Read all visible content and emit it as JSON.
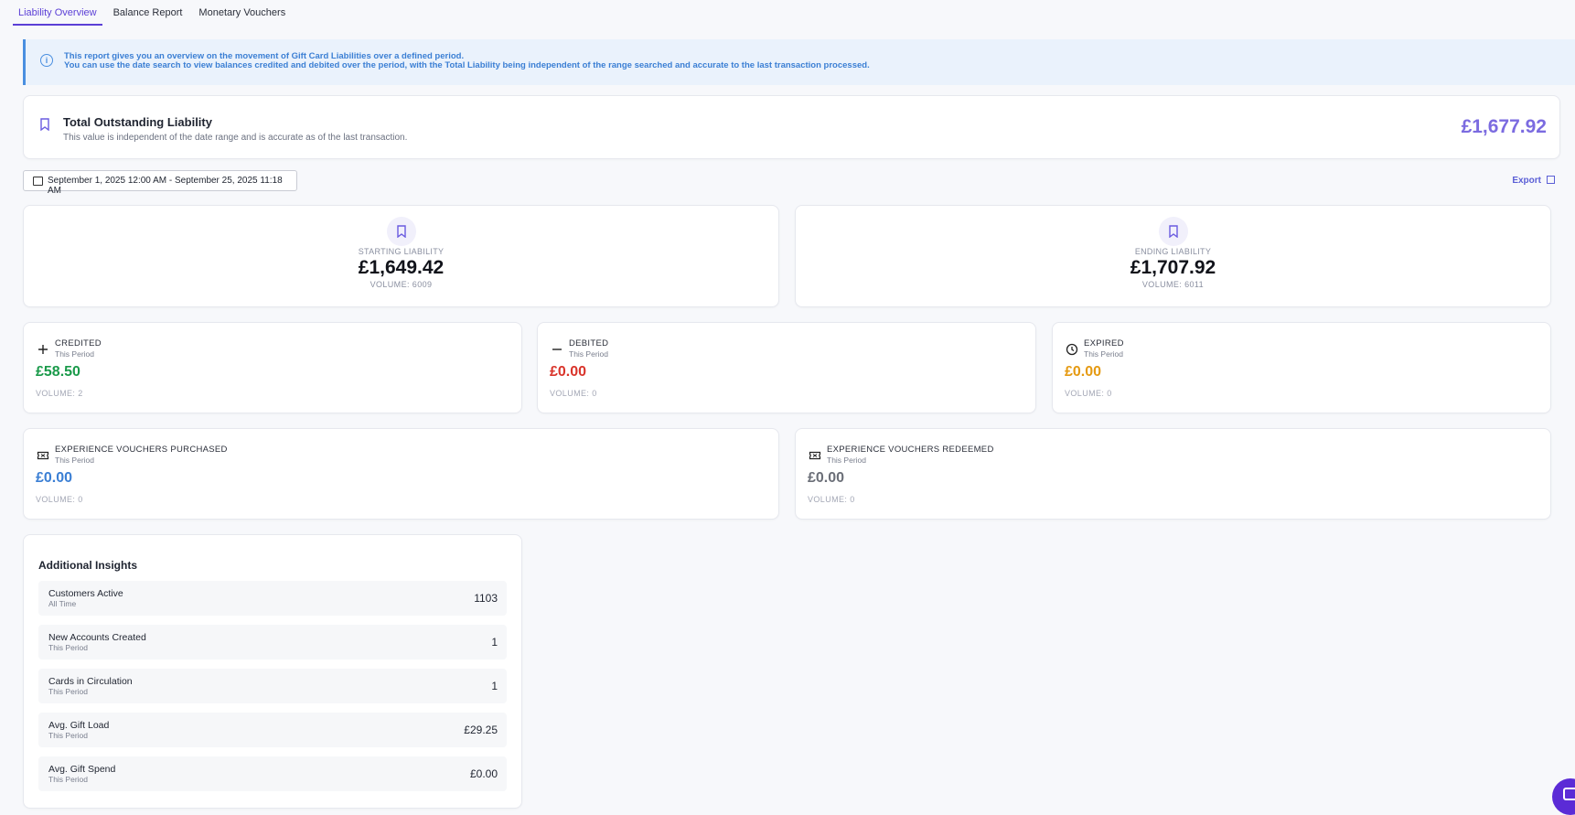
{
  "tabs": [
    {
      "label": "Liability Overview",
      "active": true
    },
    {
      "label": "Balance Report",
      "active": false
    },
    {
      "label": "Monetary Vouchers",
      "active": false
    }
  ],
  "info": {
    "line1": "This report gives you an overview on the movement of Gift Card Liabilities over a defined period.",
    "line2": "You can use the date search to view balances credited and debited over the period, with the Total Liability being independent of the range searched and accurate to the last transaction processed."
  },
  "total": {
    "title": "Total Outstanding Liability",
    "subtitle": "This value is independent of the date range and is accurate as of the last transaction.",
    "amount": "£1,677.92"
  },
  "date_range": "September 1, 2025 12:00 AM - September 25, 2025 11:18 AM",
  "export_label": "Export",
  "starting": {
    "label": "STARTING LIABILITY",
    "value": "£1,649.42",
    "volume": "VOLUME: 6009"
  },
  "ending": {
    "label": "ENDING LIABILITY",
    "value": "£1,707.92",
    "volume": "VOLUME: 6011"
  },
  "credited": {
    "label": "CREDITED",
    "period": "This Period",
    "value": "£58.50",
    "volume": "VOLUME: 2",
    "color": "#1a9a4a"
  },
  "debited": {
    "label": "DEBITED",
    "period": "This Period",
    "value": "£0.00",
    "volume": "VOLUME: 0",
    "color": "#d9342b"
  },
  "expired": {
    "label": "EXPIRED",
    "period": "This Period",
    "value": "£0.00",
    "volume": "VOLUME: 0",
    "color": "#e59a12"
  },
  "exp_purchased": {
    "label": "EXPERIENCE VOUCHERS PURCHASED",
    "period": "This Period",
    "value": "£0.00",
    "volume": "VOLUME: 0",
    "color": "#3b7fd4"
  },
  "exp_redeemed": {
    "label": "EXPERIENCE VOUCHERS REDEEMED",
    "period": "This Period",
    "value": "£0.00",
    "volume": "VOLUME: 0",
    "color": "#6b6f78"
  },
  "insights": {
    "title": "Additional Insights",
    "rows": [
      {
        "name": "Customers Active",
        "sub": "All Time",
        "value": "1103"
      },
      {
        "name": "New Accounts Created",
        "sub": "This Period",
        "value": "1"
      },
      {
        "name": "Cards in Circulation",
        "sub": "This Period",
        "value": "1"
      },
      {
        "name": "Avg. Gift Load",
        "sub": "This Period",
        "value": "£29.25"
      },
      {
        "name": "Avg. Gift Spend",
        "sub": "This Period",
        "value": "£0.00"
      }
    ]
  },
  "accent_color": "#5b3fd6"
}
